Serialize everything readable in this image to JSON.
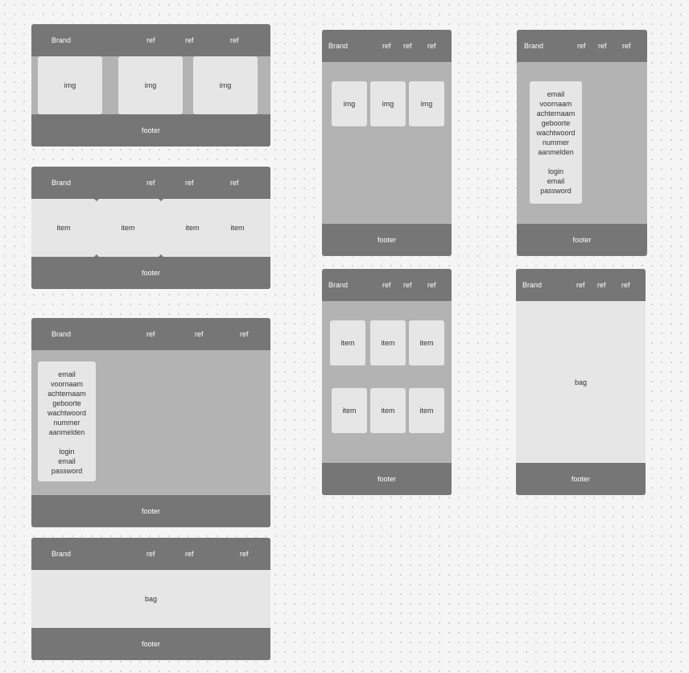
{
  "nav": {
    "brand": "Brand",
    "ref": "ref"
  },
  "footer": "footer",
  "img": "img",
  "item": "item",
  "bag": "bag",
  "form": {
    "register_fields": [
      "email",
      "voornaam",
      "achternaam",
      "geboorte",
      "wachtwoord",
      "nummer",
      "aanmelden"
    ],
    "login_fields": [
      "login",
      "email",
      "password"
    ]
  }
}
